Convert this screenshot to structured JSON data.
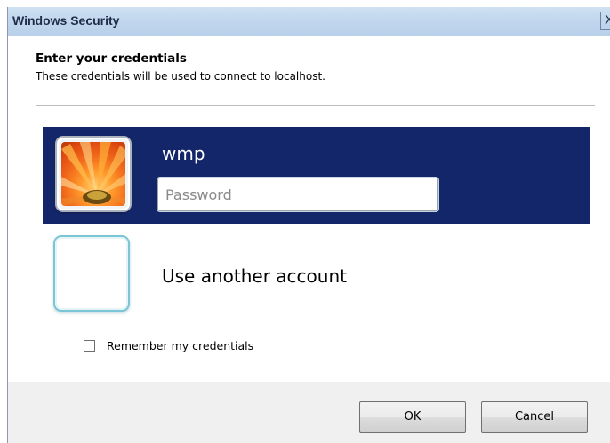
{
  "window": {
    "title": "Windows Security",
    "close_glyph": "X"
  },
  "prompt": {
    "heading": "Enter your credentials",
    "subheading": "These credentials will be used to connect to localhost."
  },
  "accounts": {
    "selected": {
      "username": "wmp",
      "password_value": "",
      "password_placeholder": "Password",
      "picture_icon": "orange-flower-icon"
    },
    "other": {
      "label": "Use another account",
      "picture_icon": "blank-user-tile-icon"
    }
  },
  "remember": {
    "label": "Remember my credentials",
    "checked": false
  },
  "buttons": {
    "ok": "OK",
    "cancel": "Cancel"
  },
  "colors": {
    "selected_account_bg": "#14266a",
    "titlebar": "#c2d7ee",
    "footer": "#f0f0f0"
  }
}
